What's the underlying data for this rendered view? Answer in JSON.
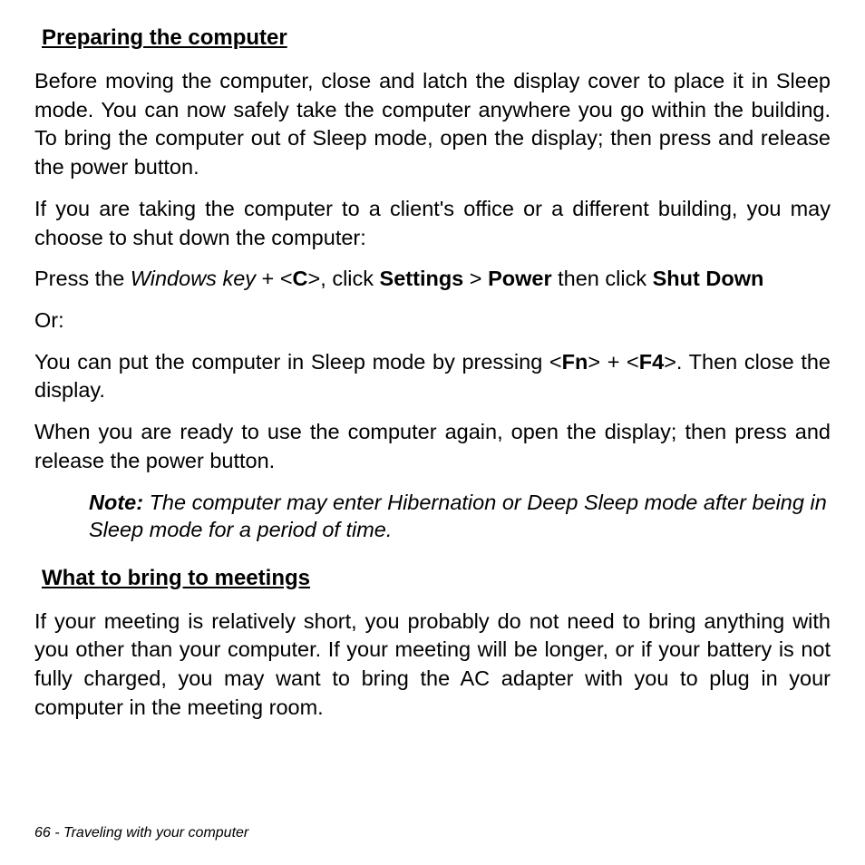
{
  "section1": {
    "heading": "Preparing the computer",
    "p1": "Before moving the computer, close and latch the display cover to place it in Sleep mode. You can now safely take the computer anywhere you go within the building. To bring the computer out of Sleep mode, open the display; then press and release the power button.",
    "p2": "If you are taking the computer to a client's office or a different building, you may choose to shut down the computer:",
    "p3_pre": "Press the ",
    "p3_winkey": "Windows key",
    "p3_plus": " + <",
    "p3_c": "C",
    "p3_after_c": ">, click ",
    "p3_settings": "Settings",
    "p3_gt": " > ",
    "p3_power": "Power",
    "p3_then": " then click ",
    "p3_shutdown": "Shut Down",
    "p4": "Or:",
    "p5_pre": "You can put the computer in Sleep mode by pressing <",
    "p5_fn": "Fn",
    "p5_mid": "> + <",
    "p5_f4": "F4",
    "p5_post": ">. Then close the display.",
    "p6": "When you are ready to use the computer again, open the display; then press and release the power button.",
    "note_label": "Note: ",
    "note_text": "The computer may enter Hibernation or Deep Sleep mode after being in Sleep mode for a period of time."
  },
  "section2": {
    "heading": "What to bring to meetings",
    "p1": "If your meeting is relatively short, you probably do not need to bring anything with you other than your computer. If your meeting will be longer, or if your battery is not fully charged, you may want to bring the AC adapter with you to plug in your computer in the meeting room."
  },
  "footer": "66 - Traveling with your computer"
}
